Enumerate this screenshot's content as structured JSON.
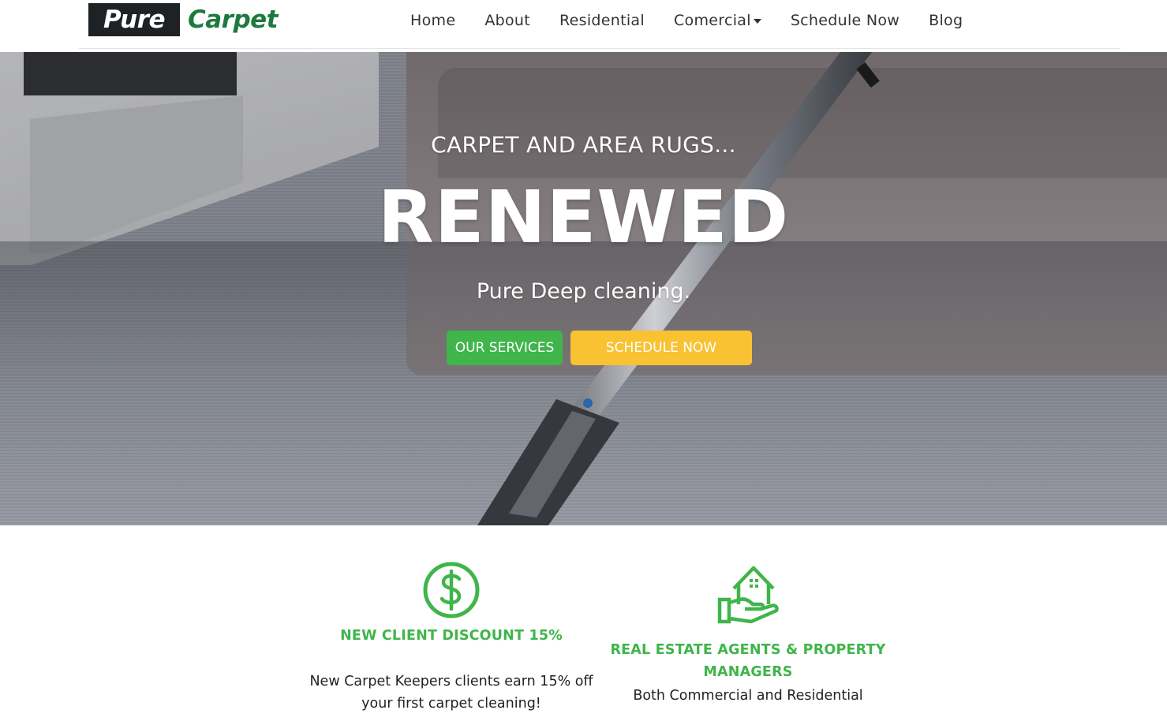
{
  "brand": {
    "part1": "Pure",
    "part2": "Carpet",
    "color_dark": "#1f2224",
    "color_green": "#1c7a3f"
  },
  "nav": {
    "items": [
      {
        "label": "Home"
      },
      {
        "label": "About"
      },
      {
        "label": "Residential"
      },
      {
        "label": "Comercial"
      },
      {
        "label": "Schedule Now"
      },
      {
        "label": "Blog"
      }
    ]
  },
  "hero": {
    "kicker": "CARPET AND AREA RUGS...",
    "title": "RENEWED",
    "subtitle": "Pure Deep cleaning.",
    "btn_services": "OUR SERVICES",
    "btn_schedule": "SCHEDULE NOW",
    "btn_services_color": "#3fb54a",
    "btn_schedule_color": "#f8c232"
  },
  "features": [
    {
      "icon": "dollar-circle-icon",
      "title": "NEW CLIENT DISCOUNT 15%",
      "text": "New Carpet Keepers clients earn 15% off your first carpet cleaning!"
    },
    {
      "icon": "house-in-hand-icon",
      "title": "REAL ESTATE AGENTS & PROPERTY MANAGERS",
      "text": "Both Commercial and Residential"
    }
  ],
  "accent_green": "#3fb54a"
}
